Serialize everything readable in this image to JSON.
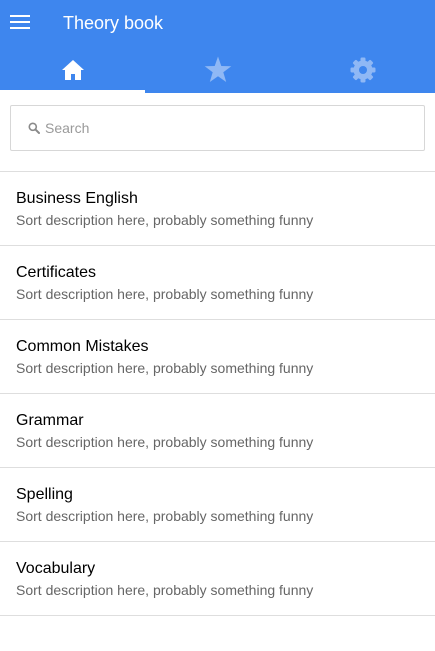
{
  "header": {
    "title": "Theory book",
    "menu_icon": "menu-icon",
    "background_color": "#3e86ee"
  },
  "tabs": [
    {
      "icon": "home-icon",
      "active": true
    },
    {
      "icon": "star-icon",
      "active": false
    },
    {
      "icon": "gear-icon",
      "active": false
    }
  ],
  "search": {
    "placeholder": "Search",
    "value": "",
    "icon": "search-icon"
  },
  "list": {
    "items": [
      {
        "title": "Business English",
        "description": "Sort description here, probably something funny"
      },
      {
        "title": "Certificates",
        "description": "Sort description here, probably something funny"
      },
      {
        "title": "Common Mistakes",
        "description": "Sort description here, probably something funny"
      },
      {
        "title": "Grammar",
        "description": "Sort description here, probably something funny"
      },
      {
        "title": "Spelling",
        "description": "Sort description here, probably something funny"
      },
      {
        "title": "Vocabulary",
        "description": "Sort description here, probably something funny"
      }
    ]
  }
}
